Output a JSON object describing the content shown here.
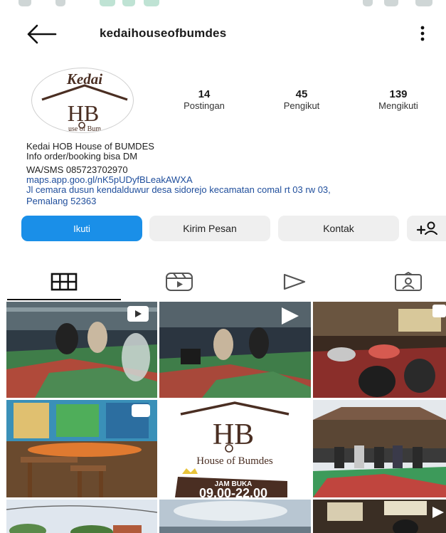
{
  "header": {
    "username": "kedaihouseofbumdes"
  },
  "avatar": {
    "logo_script": "Kedai",
    "logo_letters": "HB",
    "logo_caption": "use of Bum"
  },
  "stats": [
    {
      "value": "14",
      "label": "Postingan"
    },
    {
      "value": "45",
      "label": "Pengikut"
    },
    {
      "value": "139",
      "label": "Mengikuti"
    }
  ],
  "bio": {
    "name": "Kedai HOB House of BUMDES",
    "line1": "Info order/booking bisa DM",
    "line2": "WA/SMS 085723702970",
    "link": "maps.app.goo.gl/nK5pUDyfBLeakAWXA",
    "location1": "Jl cemara dusun kendalduwur desa sidorejo kecamatan comal rt 03 rw 03,",
    "location2": "Pemalang 52363"
  },
  "buttons": {
    "follow": "Ikuti",
    "message": "Kirim Pesan",
    "contact": "Kontak"
  },
  "tabs": [
    "grid-icon",
    "reels-icon",
    "video-play-icon",
    "tagged-icon"
  ],
  "posts": {
    "post5_letters": "HB",
    "post5_caption": "House of Bumdes",
    "post5_hours_label": "JAM BUKA",
    "post5_hours": "09.00-22.00"
  },
  "colors": {
    "primary_button": "#1a8fe8",
    "secondary_button": "#efefef",
    "link": "#1f4e9c",
    "logo_brown": "#4a2e22"
  }
}
